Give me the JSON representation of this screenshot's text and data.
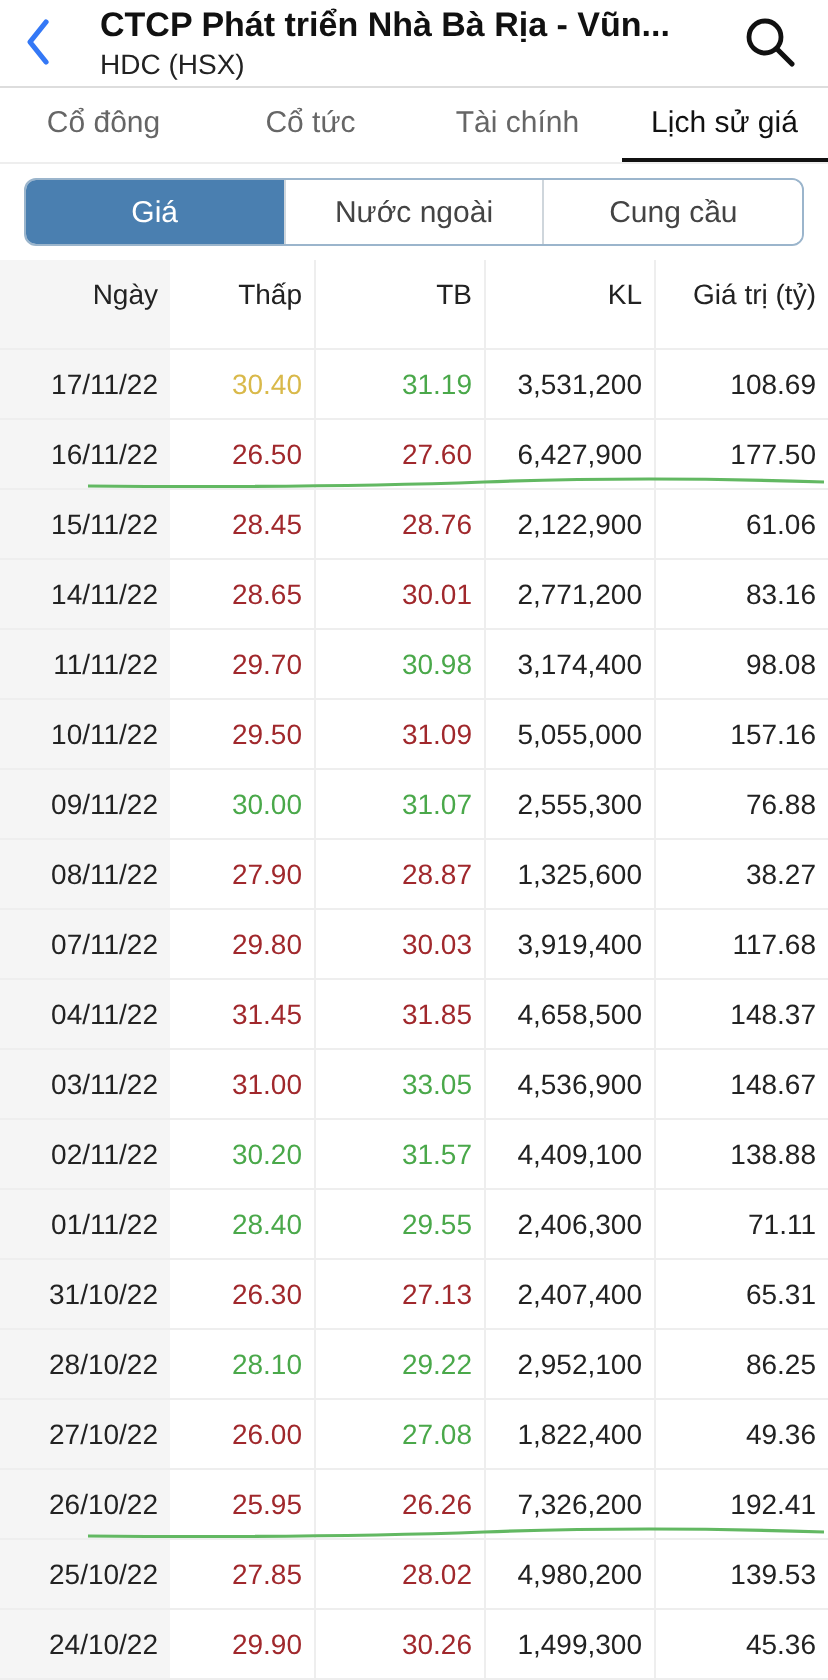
{
  "header": {
    "title": "CTCP Phát triển Nhà Bà Rịa - Vũn...",
    "subtitle": "HDC (HSX)"
  },
  "tabs": [
    {
      "label": "Cổ đông",
      "selected": false
    },
    {
      "label": "Cổ tức",
      "selected": false
    },
    {
      "label": "Tài chính",
      "selected": false
    },
    {
      "label": "Lịch sử giá",
      "selected": true
    }
  ],
  "segments": [
    {
      "label": "Giá",
      "selected": true
    },
    {
      "label": "Nước ngoài",
      "selected": false
    },
    {
      "label": "Cung cầu",
      "selected": false
    }
  ],
  "table": {
    "columns": [
      "Ngày",
      "Thấp",
      "TB",
      "KL",
      "Giá trị (tỷ)"
    ],
    "rows": [
      {
        "date": "17/11/22",
        "low": {
          "text": "30.40",
          "color": "#d9b94a"
        },
        "avg": {
          "text": "31.19",
          "color": "#4aa84a"
        },
        "volume": "3,531,200",
        "value": "108.69",
        "marked": false
      },
      {
        "date": "16/11/22",
        "low": {
          "text": "26.50",
          "color": "#a0282c"
        },
        "avg": {
          "text": "27.60",
          "color": "#a0282c"
        },
        "volume": "6,427,900",
        "value": "177.50",
        "marked": true
      },
      {
        "date": "15/11/22",
        "low": {
          "text": "28.45",
          "color": "#a0282c"
        },
        "avg": {
          "text": "28.76",
          "color": "#a0282c"
        },
        "volume": "2,122,900",
        "value": "61.06",
        "marked": false
      },
      {
        "date": "14/11/22",
        "low": {
          "text": "28.65",
          "color": "#a0282c"
        },
        "avg": {
          "text": "30.01",
          "color": "#a0282c"
        },
        "volume": "2,771,200",
        "value": "83.16",
        "marked": false
      },
      {
        "date": "11/11/22",
        "low": {
          "text": "29.70",
          "color": "#a0282c"
        },
        "avg": {
          "text": "30.98",
          "color": "#4aa84a"
        },
        "volume": "3,174,400",
        "value": "98.08",
        "marked": false
      },
      {
        "date": "10/11/22",
        "low": {
          "text": "29.50",
          "color": "#a0282c"
        },
        "avg": {
          "text": "31.09",
          "color": "#a0282c"
        },
        "volume": "5,055,000",
        "value": "157.16",
        "marked": false
      },
      {
        "date": "09/11/22",
        "low": {
          "text": "30.00",
          "color": "#4aa84a"
        },
        "avg": {
          "text": "31.07",
          "color": "#4aa84a"
        },
        "volume": "2,555,300",
        "value": "76.88",
        "marked": false
      },
      {
        "date": "08/11/22",
        "low": {
          "text": "27.90",
          "color": "#a0282c"
        },
        "avg": {
          "text": "28.87",
          "color": "#a0282c"
        },
        "volume": "1,325,600",
        "value": "38.27",
        "marked": false
      },
      {
        "date": "07/11/22",
        "low": {
          "text": "29.80",
          "color": "#a0282c"
        },
        "avg": {
          "text": "30.03",
          "color": "#a0282c"
        },
        "volume": "3,919,400",
        "value": "117.68",
        "marked": false
      },
      {
        "date": "04/11/22",
        "low": {
          "text": "31.45",
          "color": "#a0282c"
        },
        "avg": {
          "text": "31.85",
          "color": "#a0282c"
        },
        "volume": "4,658,500",
        "value": "148.37",
        "marked": false
      },
      {
        "date": "03/11/22",
        "low": {
          "text": "31.00",
          "color": "#a0282c"
        },
        "avg": {
          "text": "33.05",
          "color": "#4aa84a"
        },
        "volume": "4,536,900",
        "value": "148.67",
        "marked": false
      },
      {
        "date": "02/11/22",
        "low": {
          "text": "30.20",
          "color": "#4aa84a"
        },
        "avg": {
          "text": "31.57",
          "color": "#4aa84a"
        },
        "volume": "4,409,100",
        "value": "138.88",
        "marked": false
      },
      {
        "date": "01/11/22",
        "low": {
          "text": "28.40",
          "color": "#4aa84a"
        },
        "avg": {
          "text": "29.55",
          "color": "#4aa84a"
        },
        "volume": "2,406,300",
        "value": "71.11",
        "marked": false
      },
      {
        "date": "31/10/22",
        "low": {
          "text": "26.30",
          "color": "#a0282c"
        },
        "avg": {
          "text": "27.13",
          "color": "#a0282c"
        },
        "volume": "2,407,400",
        "value": "65.31",
        "marked": false
      },
      {
        "date": "28/10/22",
        "low": {
          "text": "28.10",
          "color": "#4aa84a"
        },
        "avg": {
          "text": "29.22",
          "color": "#4aa84a"
        },
        "volume": "2,952,100",
        "value": "86.25",
        "marked": false
      },
      {
        "date": "27/10/22",
        "low": {
          "text": "26.00",
          "color": "#a0282c"
        },
        "avg": {
          "text": "27.08",
          "color": "#4aa84a"
        },
        "volume": "1,822,400",
        "value": "49.36",
        "marked": false
      },
      {
        "date": "26/10/22",
        "low": {
          "text": "25.95",
          "color": "#a0282c"
        },
        "avg": {
          "text": "26.26",
          "color": "#a0282c"
        },
        "volume": "7,326,200",
        "value": "192.41",
        "marked": true
      },
      {
        "date": "25/10/22",
        "low": {
          "text": "27.85",
          "color": "#a0282c"
        },
        "avg": {
          "text": "28.02",
          "color": "#a0282c"
        },
        "volume": "4,980,200",
        "value": "139.53",
        "marked": false
      },
      {
        "date": "24/10/22",
        "low": {
          "text": "29.90",
          "color": "#a0282c"
        },
        "avg": {
          "text": "30.26",
          "color": "#a0282c"
        },
        "volume": "1,499,300",
        "value": "45.36",
        "marked": false
      }
    ]
  }
}
